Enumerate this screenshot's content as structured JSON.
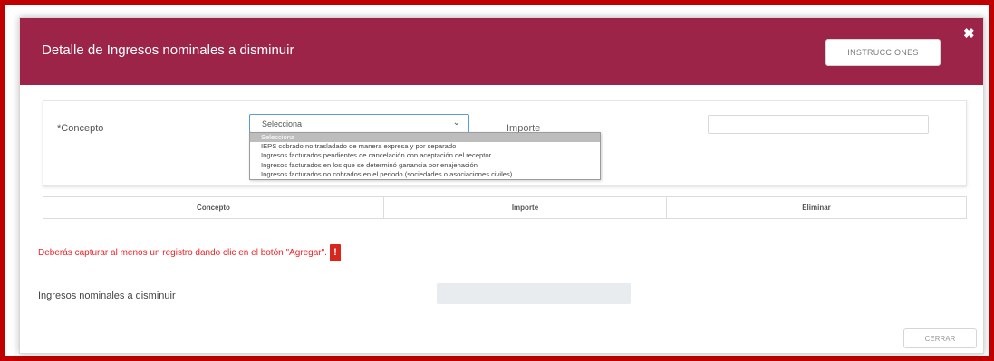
{
  "modal": {
    "title": "Detalle de Ingresos nominales a disminuir",
    "instructions_label": "INSTRUCCIONES",
    "close_glyph": "✖",
    "header_color": "#9d2449"
  },
  "form": {
    "concepto_label": "*Concepto",
    "concepto_selected": "Selecciona",
    "importe_label": "Importe",
    "importe_value": "",
    "options": [
      "Selecciona",
      "IEPS cobrado no trasladado de manera expresa y por separado",
      "Ingresos facturados pendientes de cancelación con aceptación del receptor",
      "Ingresos facturados en los que se determinó ganancia por enajenación",
      "Ingresos facturados no cobrados en el periodo (sociedades o asociaciones civiles)"
    ]
  },
  "table": {
    "headers": [
      "Concepto",
      "Importe",
      "Eliminar"
    ]
  },
  "messages": {
    "error": "Deberás capturar al menos un registro dando clic en el botón \"Agregar\".",
    "warning_glyph": "!"
  },
  "total": {
    "label": "Ingresos nominales a disminuir",
    "value": ""
  },
  "footer": {
    "close_label": "CERRAR"
  },
  "colors": {
    "accent": "#9d2449",
    "error": "#e8232a",
    "border_highlight": "#c00000"
  }
}
